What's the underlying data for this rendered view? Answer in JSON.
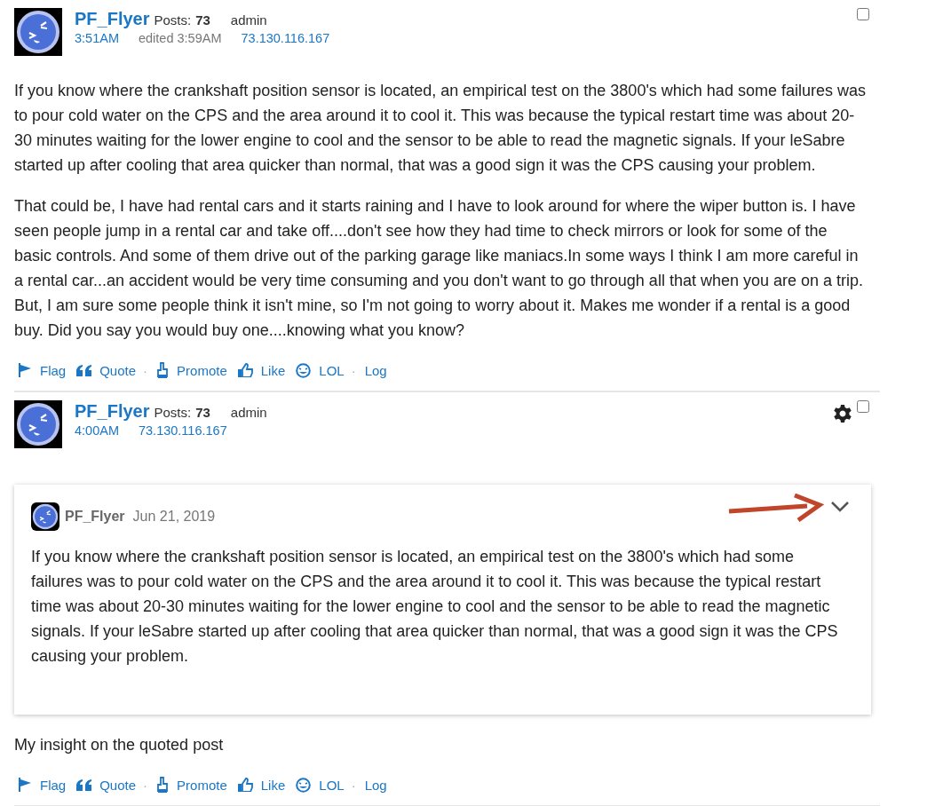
{
  "posts": [
    {
      "author": "PF_Flyer",
      "posts_label": "Posts:",
      "posts_count": "73",
      "role": "admin",
      "time": "3:51AM",
      "edited": "edited 3:59AM",
      "ip": "73.130.116.167",
      "settings": false,
      "checked": false,
      "paragraphs": [
        "If you know where the crankshaft position sensor is located, an empirical test on the 3800's which had some failures was to pour cold water on the CPS and the area around it to cool it. This was because the typical restart time was about 20-30 minutes waiting for the lower engine to cool and the sensor to be able to read the magnetic signals. If your leSabre started up after cooling that area quicker than normal, that was a good sign it was the CPS causing your problem.",
        "That could be, I have had rental cars and it starts raining and I have to look around for where the wiper button is. I have seen people jump in a rental car and take off....don't see how they had time to check mirrors or look for some of the basic controls. And some of them drive out of the parking garage like maniacs.In some ways I think I am more careful in a rental car...an accident would be very time consuming and you don't want to go through all that when you are on a trip. But, I am sure some people think it isn't mine, so I'm not going to worry about it. Makes me wonder if a rental is a good buy. Did you say you would buy one....knowing what you know?"
      ],
      "actions": [
        {
          "kind": "flag",
          "label": "Flag"
        },
        {
          "kind": "quote",
          "label": "Quote"
        },
        {
          "kind": "separator",
          "label": "·"
        },
        {
          "kind": "promote",
          "label": "Promote"
        },
        {
          "kind": "like",
          "label": "Like"
        },
        {
          "kind": "lol",
          "label": "LOL"
        },
        {
          "kind": "separator",
          "label": "·"
        },
        {
          "kind": "log",
          "label": "Log"
        }
      ]
    },
    {
      "author": "PF_Flyer",
      "posts_label": "Posts:",
      "posts_count": "73",
      "role": "admin",
      "time": "4:00AM",
      "ip": "73.130.116.167",
      "settings": true,
      "checked": false,
      "quote": {
        "author": "PF_Flyer",
        "date": "Jun 21, 2019",
        "text": "If you know where the crankshaft position sensor is located, an empirical test on the 3800's which had some failures was to pour cold water on the CPS and the area around it to cool it. This was because the typical restart time was about 20-30 minutes waiting for the lower engine to cool and the sensor to be able to read the magnetic signals. If your leSabre started up after cooling that area quicker than normal, that was a good sign it was the CPS causing your problem."
      },
      "paragraphs": [
        "My insight on the quoted post"
      ],
      "actions": [
        {
          "kind": "flag",
          "label": "Flag"
        },
        {
          "kind": "quote",
          "label": "Quote"
        },
        {
          "kind": "separator",
          "label": "·"
        },
        {
          "kind": "promote",
          "label": "Promote"
        },
        {
          "kind": "like",
          "label": "Like"
        },
        {
          "kind": "lol",
          "label": "LOL"
        },
        {
          "kind": "separator",
          "label": "·"
        },
        {
          "kind": "log",
          "label": "Log"
        }
      ]
    }
  ]
}
